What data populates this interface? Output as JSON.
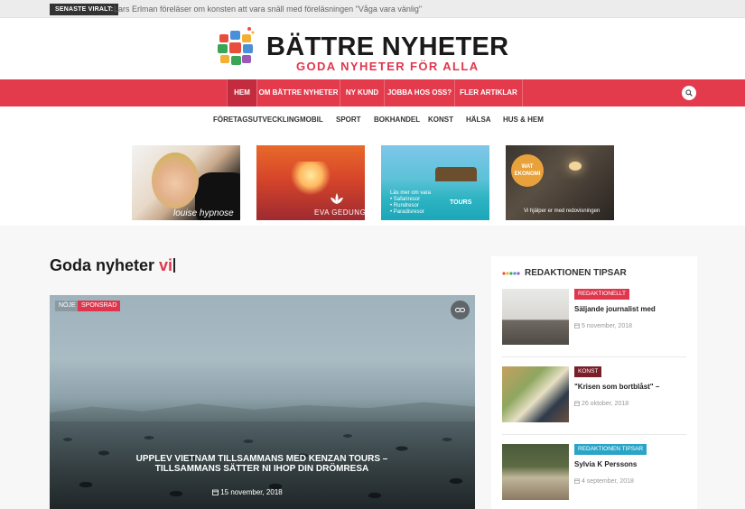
{
  "ticker": {
    "badge": "SENASTE VIRALT:",
    "text": "Lars Erlman föreläser om konsten att vara snäll med föreläsningen \"Våga vara vänlig\""
  },
  "brand": {
    "title": "BÄTTRE NYHETER",
    "tagline": "GODA NYHETER FÖR ALLA",
    "accent_color": "#e0364d"
  },
  "main_nav": {
    "items": [
      {
        "label": "HEM",
        "active": true
      },
      {
        "label": "OM BÄTTRE NYHETER"
      },
      {
        "label": "NY KUND"
      },
      {
        "label": "JOBBA HOS OSS?"
      },
      {
        "label": "FLER ARTIKLAR"
      }
    ],
    "search_icon": "search-icon",
    "bg_color": "#e33a4c"
  },
  "sub_nav": {
    "items": [
      "FÖRETAGSUTVECKLING",
      "MOBIL",
      "SPORT",
      "BOKHANDEL",
      "KONST",
      "HÄLSA",
      "HUS & HEM"
    ]
  },
  "ads": [
    {
      "caption": "louise hypnose"
    },
    {
      "caption": "EVA GEDUNG"
    },
    {
      "lines": [
        "Läs mer om vara",
        "• Safariresor",
        "• Rundresor",
        "• Paradisresor"
      ],
      "brand": "TOURS"
    },
    {
      "badge": "WAT EKONOMI",
      "caption": "Vi hjälper er med redovisningen"
    }
  ],
  "headline": {
    "main": "Goda nyheter ",
    "accent": "vi"
  },
  "feature": {
    "tags": [
      "NÖJE",
      "SPONSRAD"
    ],
    "title": "Upplev Vietnam tillsammans med Kenzan Tours – Tillsammans sätter ni ihop din drömresa",
    "date": "15 november, 2018"
  },
  "sidebar": {
    "title": "REDAKTIONEN TIPSAR",
    "posts": [
      {
        "tag": "REDAKTIONELLT",
        "tag_color": "#e0364d",
        "title": "Säljande journalist med",
        "date": "5 november, 2018"
      },
      {
        "tag": "KONST",
        "tag_color": "#7a1f2a",
        "title": "\"Krisen som bortblåst\" –",
        "date": "26 oktober, 2018"
      },
      {
        "tag": "REDAKTIONEN TIPSAR",
        "tag_color": "#2aa5c8",
        "title": "Sylvia K Perssons",
        "date": "4 september, 2018"
      }
    ]
  }
}
